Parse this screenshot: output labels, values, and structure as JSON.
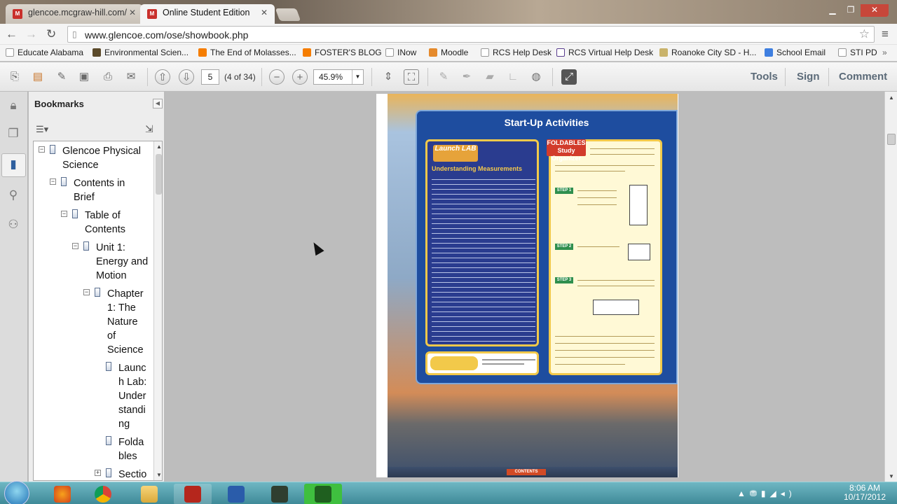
{
  "browser": {
    "tabs": [
      {
        "label": "glencoe.mcgraw-hill.com/",
        "icon": "mcgraw-hill-favicon"
      },
      {
        "label": "Online Student Edition",
        "icon": "mcgraw-hill-favicon"
      }
    ],
    "url": "www.glencoe.com/ose/showbook.php",
    "bookmarks": [
      {
        "label": "Educate Alabama",
        "icon": "page-icon"
      },
      {
        "label": "Environmental Scien...",
        "icon": "paw-icon"
      },
      {
        "label": "The End of Molasses...",
        "icon": "blogger-icon"
      },
      {
        "label": "FOSTER'S BLOG",
        "icon": "blogger-icon"
      },
      {
        "label": "INow",
        "icon": "page-icon"
      },
      {
        "label": "Moodle",
        "icon": "moodle-icon"
      },
      {
        "label": "RCS Help Desk",
        "icon": "page-icon"
      },
      {
        "label": "RCS Virtual Help Desk",
        "icon": "window-icon"
      },
      {
        "label": "Roanoke City SD - H...",
        "icon": "shield-icon"
      },
      {
        "label": "School Email",
        "icon": "google-icon"
      },
      {
        "label": "STI PD",
        "icon": "page-icon"
      }
    ]
  },
  "reader": {
    "page_number": "5",
    "page_count": "(4 of 34)",
    "zoom": "45.9%",
    "right_tools": [
      "Tools",
      "Sign",
      "Comment"
    ]
  },
  "bookmarks_panel": {
    "title": "Bookmarks",
    "items": [
      {
        "label": "Glencoe Physical Science",
        "lines": [
          "Glencoe Physical",
          "Science"
        ]
      },
      {
        "label": "Contents in Brief",
        "lines": [
          "Contents in",
          "Brief"
        ]
      },
      {
        "label": "Table of Contents",
        "lines": [
          "Table of",
          "Contents"
        ]
      },
      {
        "label": "Unit 1: Energy and Motion",
        "lines": [
          "Unit 1:",
          "Energy and",
          "Motion"
        ]
      },
      {
        "label": "Chapter 1: The Nature of Science",
        "lines": [
          "Chapter",
          "1: The",
          "Nature",
          "of",
          "Science"
        ]
      },
      {
        "label": "Launch Lab: Understanding",
        "lines": [
          "Launc",
          "h Lab:",
          "Under",
          "standi",
          "ng"
        ]
      },
      {
        "label": "Foldables",
        "lines": [
          "Folda",
          "bles"
        ]
      },
      {
        "label": "Section",
        "lines": [
          "Sectio"
        ]
      }
    ]
  },
  "document": {
    "heading": "Start-Up Activities",
    "launch_lab": {
      "logo": "Launch LAB",
      "title": "Understanding Measurements"
    },
    "foldables": {
      "logo": "FOLDABLES Study Organizer",
      "steps": [
        "STEP 1",
        "STEP 2",
        "STEP 3"
      ]
    },
    "footer_button": "CONTENTS"
  },
  "taskbar": {
    "apps": [
      "firefox-icon",
      "chrome-icon",
      "explorer-icon",
      "mcgraw-hill-icon",
      "word-icon",
      "terminal-icon",
      "app-icon"
    ],
    "time": "8:06 AM",
    "date": "10/17/2012"
  }
}
